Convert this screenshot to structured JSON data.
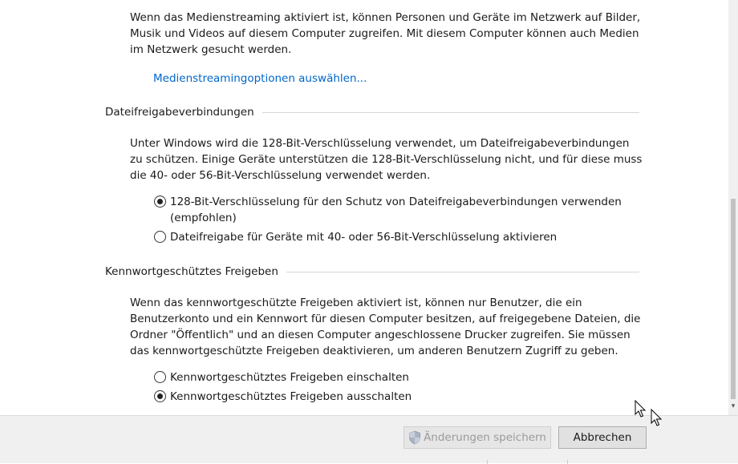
{
  "media_streaming": {
    "description": "Wenn das Medienstreaming aktiviert ist, können Personen und Geräte im Netzwerk auf Bilder, Musik und Videos auf diesem Computer zugreifen. Mit diesem Computer können auch Medien im Netzwerk gesucht werden.",
    "link": "Medienstreamingoptionen auswählen..."
  },
  "file_sharing": {
    "title": "Dateifreigabeverbindungen",
    "description": "Unter Windows wird die 128-Bit-Verschlüsselung verwendet, um Dateifreigabeverbindungen zu schützen. Einige Geräte unterstützen die 128-Bit-Verschlüsselung nicht, und für diese muss die 40- oder 56-Bit-Verschlüsselung verwendet werden.",
    "options": [
      {
        "label": "128-Bit-Verschlüsselung für den Schutz von Dateifreigabeverbindungen verwenden (empfohlen)",
        "checked": true
      },
      {
        "label": "Dateifreigabe für Geräte mit 40- oder 56-Bit-Verschlüsselung aktivieren",
        "checked": false
      }
    ]
  },
  "password_sharing": {
    "title": "Kennwortgeschütztes Freigeben",
    "description": "Wenn das kennwortgeschützte Freigeben aktiviert ist, können nur Benutzer, die ein Benutzerkonto und ein Kennwort für diesen Computer besitzen, auf freigegebene Dateien, die Ordner \"Öffentlich\" und an diesen Computer angeschlossene Drucker zugreifen. Sie müssen das kennwortgeschützte Freigeben deaktivieren, um anderen Benutzern Zugriff zu geben.",
    "options": [
      {
        "label": "Kennwortgeschütztes Freigeben einschalten",
        "checked": false
      },
      {
        "label": "Kennwortgeschütztes Freigeben ausschalten",
        "checked": true
      }
    ]
  },
  "footer": {
    "save_label": "Änderungen speichern",
    "cancel_label": "Abbrechen",
    "save_icon": "uac-shield-icon"
  },
  "colors": {
    "link": "#0066cc",
    "footer_bg": "#f0f0f0"
  }
}
